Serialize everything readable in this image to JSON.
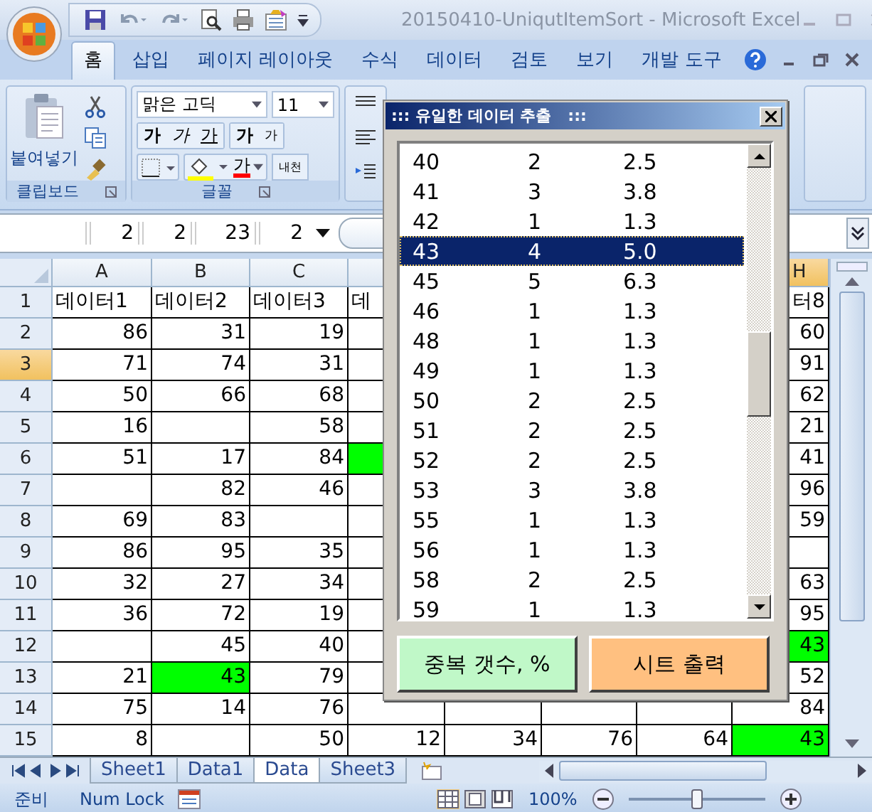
{
  "window": {
    "title": "20150410-UniqutItemSort - Microsoft Excel"
  },
  "ribbon_tabs": [
    {
      "label": "홈",
      "selected": true
    },
    {
      "label": "삽입",
      "selected": false
    },
    {
      "label": "페이지 레이아웃",
      "selected": false
    },
    {
      "label": "수식",
      "selected": false
    },
    {
      "label": "데이터",
      "selected": false
    },
    {
      "label": "검토",
      "selected": false
    },
    {
      "label": "보기",
      "selected": false
    },
    {
      "label": "개발 도구",
      "selected": false
    }
  ],
  "clipboard": {
    "paste": "붙여넣기",
    "group_label": "클립보드"
  },
  "font_group": {
    "font_name": "맑은 고딕",
    "font_size": "11",
    "bold": "가",
    "italic": "가",
    "underline": "가",
    "font_color": "가",
    "grow": "가",
    "shrink": "가",
    "phonetic": "내천",
    "group_label": "글꼴"
  },
  "formula_bar": {
    "fragments": [
      "2",
      "2",
      "23",
      "2"
    ]
  },
  "columns": [
    {
      "label": "A",
      "selected": false
    },
    {
      "label": "B",
      "selected": false
    },
    {
      "label": "C",
      "selected": false
    },
    {},
    {},
    {},
    {},
    {
      "label": "H",
      "selected": true
    }
  ],
  "rows": [
    {
      "label": "1",
      "selected": false,
      "kind": "text",
      "cells": {
        "A": "데이터1",
        "B": "데이터2",
        "C": "데이터3",
        "D": "데",
        "H": "터8"
      }
    },
    {
      "label": "2",
      "selected": false,
      "kind": "number",
      "cells": {
        "A": "86",
        "B": "31",
        "C": "19",
        "H": "60"
      }
    },
    {
      "label": "3",
      "selected": true,
      "kind": "number",
      "cells": {
        "A": "71",
        "B": "74",
        "C": "31",
        "H": "91"
      }
    },
    {
      "label": "4",
      "selected": false,
      "kind": "number",
      "cells": {
        "A": "50",
        "B": "66",
        "C": "68",
        "H": "62"
      }
    },
    {
      "label": "5",
      "selected": false,
      "kind": "number",
      "cells": {
        "A": "16",
        "C": "58",
        "H": "21"
      }
    },
    {
      "label": "6",
      "selected": false,
      "kind": "number",
      "cells": {
        "A": "51",
        "B": "17",
        "C": "84",
        "D": {
          "color": "#00ff00"
        },
        "H": "41"
      }
    },
    {
      "label": "7",
      "selected": false,
      "kind": "number",
      "cells": {
        "B": "82",
        "C": "46",
        "H": "96"
      }
    },
    {
      "label": "8",
      "selected": false,
      "kind": "number",
      "cells": {
        "A": "69",
        "B": "83",
        "H": "59"
      }
    },
    {
      "label": "9",
      "selected": false,
      "kind": "number",
      "cells": {
        "A": "86",
        "B": "95",
        "C": "35"
      }
    },
    {
      "label": "10",
      "selected": false,
      "kind": "number",
      "cells": {
        "A": "32",
        "B": "27",
        "C": "34",
        "H": "63"
      }
    },
    {
      "label": "11",
      "selected": false,
      "kind": "number",
      "cells": {
        "A": "36",
        "B": "72",
        "C": "19",
        "H": "95"
      }
    },
    {
      "label": "12",
      "selected": false,
      "kind": "number",
      "cells": {
        "B": "45",
        "C": "40",
        "H": {
          "value": "43",
          "color": "#00ff00"
        }
      }
    },
    {
      "label": "13",
      "selected": false,
      "kind": "number",
      "cells": {
        "A": "21",
        "B": {
          "value": "43",
          "color": "#00ff00"
        },
        "C": "79",
        "H": "52"
      }
    },
    {
      "label": "14",
      "selected": false,
      "kind": "number",
      "cells": {
        "A": "75",
        "B": "14",
        "C": "76",
        "H": "84"
      }
    },
    {
      "label": "15",
      "selected": false,
      "kind": "number",
      "cells": {
        "A": "8",
        "C": "50",
        "D": "12",
        "E": "34",
        "F": "76",
        "G": "64",
        "H": {
          "value": "43",
          "color": "#00ff00"
        }
      }
    }
  ],
  "sheet_tabs": [
    {
      "label": "Sheet1",
      "selected": false
    },
    {
      "label": "Data1",
      "selected": false
    },
    {
      "label": "Data",
      "selected": true
    },
    {
      "label": "Sheet3",
      "selected": false
    }
  ],
  "status_bar": {
    "state": "준비",
    "num_lock": "Num Lock",
    "zoom": {
      "label": "100%",
      "level": 0.5
    }
  },
  "dialog": {
    "title": "::: 유일한 데이터 추출   :::",
    "list": [
      {
        "value": "40",
        "count": "2",
        "percent": "2.5",
        "selected": false
      },
      {
        "value": "41",
        "count": "3",
        "percent": "3.8",
        "selected": false
      },
      {
        "value": "42",
        "count": "1",
        "percent": "1.3",
        "selected": false
      },
      {
        "value": "43",
        "count": "4",
        "percent": "5.0",
        "selected": true
      },
      {
        "value": "45",
        "count": "5",
        "percent": "6.3",
        "selected": false
      },
      {
        "value": "46",
        "count": "1",
        "percent": "1.3",
        "selected": false
      },
      {
        "value": "48",
        "count": "1",
        "percent": "1.3",
        "selected": false
      },
      {
        "value": "49",
        "count": "1",
        "percent": "1.3",
        "selected": false
      },
      {
        "value": "50",
        "count": "2",
        "percent": "2.5",
        "selected": false
      },
      {
        "value": "51",
        "count": "2",
        "percent": "2.5",
        "selected": false
      },
      {
        "value": "52",
        "count": "2",
        "percent": "2.5",
        "selected": false
      },
      {
        "value": "53",
        "count": "3",
        "percent": "3.8",
        "selected": false
      },
      {
        "value": "55",
        "count": "1",
        "percent": "1.3",
        "selected": false
      },
      {
        "value": "56",
        "count": "1",
        "percent": "1.3",
        "selected": false
      },
      {
        "value": "58",
        "count": "2",
        "percent": "2.5",
        "selected": false
      },
      {
        "value": "59",
        "count": "1",
        "percent": "1.3",
        "selected": false
      }
    ],
    "buttons": [
      {
        "label": "중복 갯수, %",
        "color": "#c0f8c8"
      },
      {
        "label": "시트 출력",
        "color": "#ffc080"
      }
    ]
  }
}
